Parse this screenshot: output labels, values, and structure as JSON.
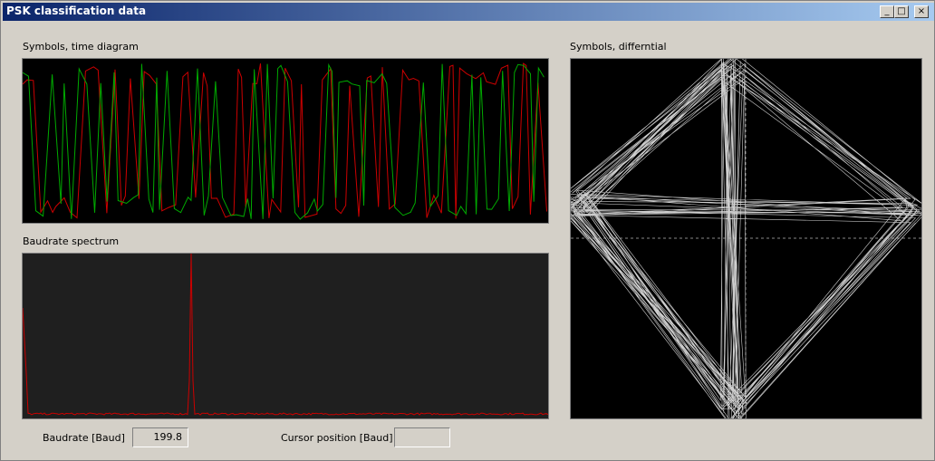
{
  "window": {
    "title": "PSK classification data",
    "minimize": "_",
    "maximize": "□",
    "close": "×"
  },
  "time_diagram": {
    "label": "Symbols, time diagram"
  },
  "spectrum": {
    "label": "Baudrate spectrum",
    "peak_baud": 199.8
  },
  "differential": {
    "label": "Symbols, differntial"
  },
  "footer": {
    "baudrate_label": "Baudrate [Baud]",
    "baudrate_value": "199.8",
    "cursor_label": "Cursor position [Baud]",
    "cursor_value": ""
  },
  "colors": {
    "panel_bg": "#000000",
    "spectrum_bg": "#1f1f1f",
    "trace_red": "#cc0000",
    "trace_green": "#00aa00",
    "constellation": "#cfcfcf"
  }
}
